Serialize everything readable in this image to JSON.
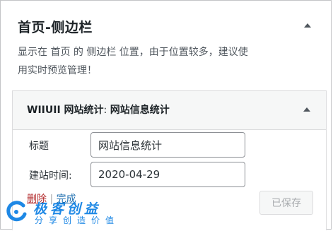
{
  "widget_area": {
    "title": "首页-侧边栏",
    "description_line1": "显示在 首页 的 侧边栏 位置，由于位置较多，建议使",
    "description_line2": "用实时预览管理！"
  },
  "widget": {
    "title_prefix": "WIIUII 网站统计",
    "title_separator": ": ",
    "title_instance": "网站信息统计",
    "fields": {
      "title": {
        "label": "标题",
        "value": "网站信息统计"
      },
      "build_date": {
        "label": "建站时间:",
        "value": "2020-04-29"
      }
    },
    "actions": {
      "delete_label": "删除",
      "separator": " | ",
      "done_label": "完成",
      "save_label": "已保存"
    }
  },
  "watermark": {
    "name": "极客创益",
    "slogan": "分享创造价值"
  },
  "colors": {
    "delete_link": "#b32d2e",
    "done_link": "#2271b1",
    "watermark": "#1e88e5",
    "border": "#c3c4c7"
  },
  "icons": {
    "area_toggle": "arrow-up-icon",
    "widget_toggle": "arrow-up-icon",
    "watermark_logo": "watermark-logo-icon"
  }
}
